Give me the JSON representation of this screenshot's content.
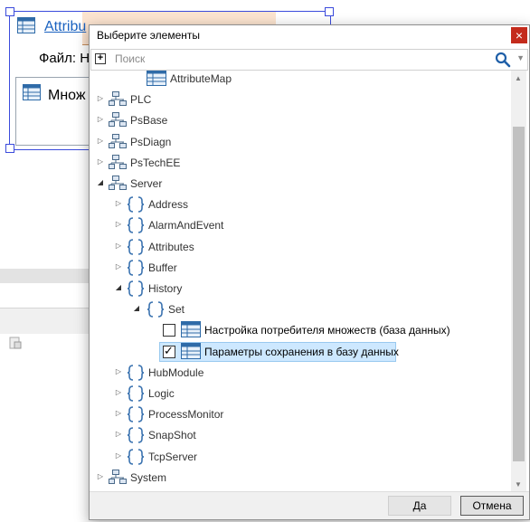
{
  "background": {
    "node_title": "Attribu",
    "file_label": "Файл: Н",
    "box_label": "Множ"
  },
  "dialog": {
    "title": "Выберите элементы",
    "close_glyph": "×",
    "search": {
      "placeholder": "Поиск",
      "value": ""
    },
    "expand_all_glyph": "+",
    "tree": [
      {
        "label": "AttributeMap",
        "icon": "table-icon",
        "arrow": "none",
        "level": 2
      },
      {
        "label": "PLC",
        "icon": "network-icon",
        "arrow": "collapsed",
        "level": 0
      },
      {
        "label": "PsBase",
        "icon": "network-icon",
        "arrow": "collapsed",
        "level": 0
      },
      {
        "label": "PsDiagn",
        "icon": "network-icon",
        "arrow": "collapsed",
        "level": 0
      },
      {
        "label": "PsTechEE",
        "icon": "network-icon",
        "arrow": "collapsed",
        "level": 0
      },
      {
        "label": "Server",
        "icon": "network-icon",
        "arrow": "expanded",
        "level": 0
      },
      {
        "label": "Address",
        "icon": "braces-icon",
        "arrow": "collapsed",
        "level": 1
      },
      {
        "label": "AlarmAndEvent",
        "icon": "braces-icon",
        "arrow": "collapsed",
        "level": 1
      },
      {
        "label": "Attributes",
        "icon": "braces-icon",
        "arrow": "collapsed",
        "level": 1
      },
      {
        "label": "Buffer",
        "icon": "braces-icon",
        "arrow": "collapsed",
        "level": 1
      },
      {
        "label": "History",
        "icon": "braces-icon",
        "arrow": "expanded",
        "level": 1
      },
      {
        "label": "Set",
        "icon": "braces-icon",
        "arrow": "expanded",
        "level": 2
      },
      {
        "label": "Настройка потребителя множеств (база данных)",
        "icon": "table-icon",
        "arrow": "none",
        "level": 3,
        "checkbox": true,
        "checked": false
      },
      {
        "label": "Параметры сохранения в базу данных",
        "icon": "table-icon",
        "arrow": "none",
        "level": 3,
        "checkbox": true,
        "checked": true,
        "selected": true
      },
      {
        "label": "HubModule",
        "icon": "braces-icon",
        "arrow": "collapsed",
        "level": 1
      },
      {
        "label": "Logic",
        "icon": "braces-icon",
        "arrow": "collapsed",
        "level": 1
      },
      {
        "label": "ProcessMonitor",
        "icon": "braces-icon",
        "arrow": "collapsed",
        "level": 1
      },
      {
        "label": "SnapShot",
        "icon": "braces-icon",
        "arrow": "collapsed",
        "level": 1
      },
      {
        "label": "TcpServer",
        "icon": "braces-icon",
        "arrow": "collapsed",
        "level": 1
      },
      {
        "label": "System",
        "icon": "network-icon",
        "arrow": "collapsed",
        "level": 0
      }
    ],
    "buttons": {
      "ok": "Да",
      "cancel": "Отмена"
    },
    "check_glyph": "✓",
    "arrow_glyphs": {
      "collapsed": "▷",
      "expanded": "◢"
    }
  },
  "colors": {
    "selection_bg": "#cde8ff",
    "close_red": "#c42b1c",
    "link_blue": "#1a62c0"
  }
}
